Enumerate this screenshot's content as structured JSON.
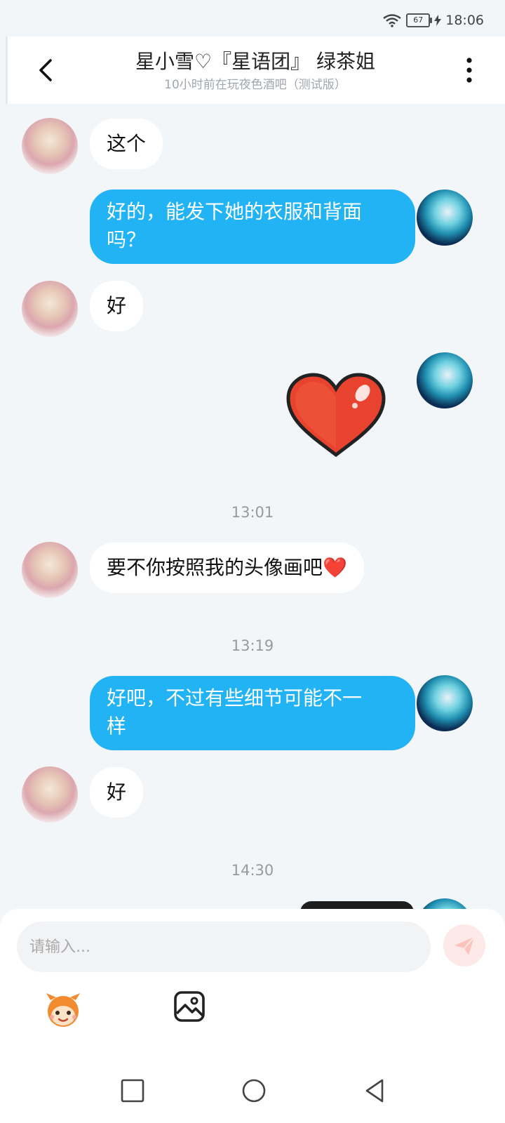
{
  "status": {
    "battery": "67",
    "time": "18:06"
  },
  "header": {
    "title": "星小雪♡『星语团』  绿茶姐",
    "subtitle": "10小时前在玩夜色酒吧（测试版）"
  },
  "messages": {
    "m1": "这个",
    "m2_line1": "好的，能发下她的衣服和背面",
    "m2_line2": "吗？",
    "m3": "好",
    "t1": "13:01",
    "m5": "要不你按照我的头像画吧❤️",
    "t2": "13:19",
    "m6_line1": "好吧，不过有些细节可能不一",
    "m6_line2": "样",
    "m7": "好",
    "t3": "14:30"
  },
  "composer": {
    "placeholder": "请输入..."
  },
  "colors": {
    "accent": "#22b3f4",
    "background": "#f3f6f9",
    "send_button": "#fdeae8"
  },
  "icons": [
    "wifi-icon",
    "battery-icon",
    "charging-icon",
    "back-arrow-icon",
    "more-vert-icon",
    "heart-sticker",
    "emoji-mascot-icon",
    "image-icon",
    "send-icon",
    "nav-square-icon",
    "nav-circle-icon",
    "nav-back-icon"
  ]
}
